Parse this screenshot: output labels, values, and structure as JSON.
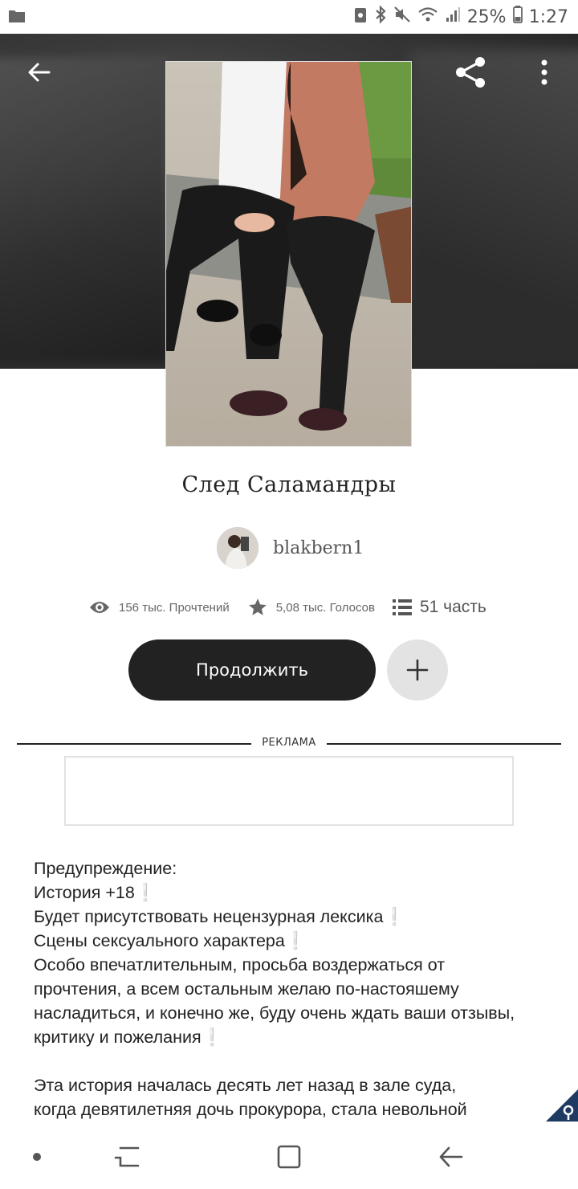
{
  "status_bar": {
    "battery": "25%",
    "time": "1:27"
  },
  "story": {
    "title": "След Саламандры",
    "author": "blakbern1"
  },
  "stats": {
    "reads": "156 тыс. Прочтений",
    "votes": "5,08 тыс. Голосов",
    "parts": "51 часть"
  },
  "actions": {
    "continue_label": "Продолжить"
  },
  "ad": {
    "label": "РЕКЛАМА"
  },
  "description": {
    "lines": [
      "Предупреждение:",
      "История +18",
      "Будет присутствовать нецензурная лексика",
      "Сцены сексуального характера",
      "Особо впечатлительным, просьба воздержаться от",
      "прочтения, а всем остальным желаю по-настояшему",
      "насладиться, и конечно же, буду очень ждать ваши отзывы,",
      "критику и пожелания",
      "Эта история началась десять лет назад в зале суда,",
      "когда девятилетняя дочь прокурора, стала невольной"
    ],
    "exclamation": "❕"
  }
}
